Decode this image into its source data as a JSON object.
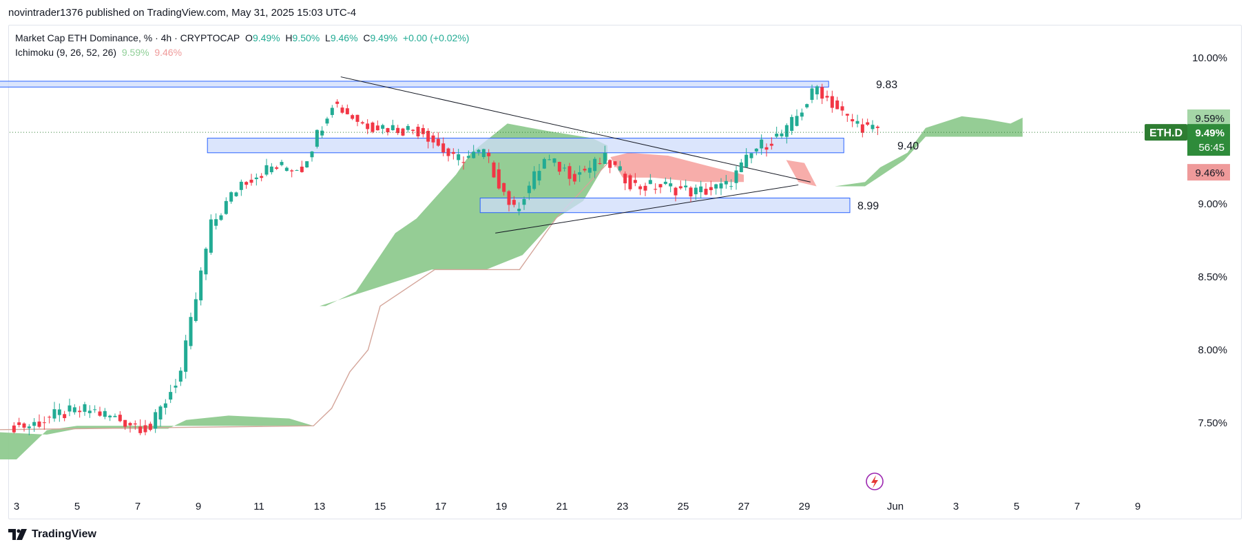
{
  "header": {
    "publisher_line": "novintrader1376 published on TradingView.com, May 31, 2025 15:03 UTC-4"
  },
  "legend": {
    "symbol_title": "Market Cap ETH Dominance, % · 4h · CRYPTOCAP",
    "open_label": "O",
    "open_value": "9.49%",
    "high_label": "H",
    "high_value": "9.50%",
    "low_label": "L",
    "low_value": "9.46%",
    "close_label": "C",
    "close_value": "9.49%",
    "change": "+0.00 (+0.02%)",
    "indicator_name": "Ichimoku (9, 26, 52, 26)",
    "indicator_value_1": "9.59%",
    "indicator_value_2": "9.46%"
  },
  "footer": {
    "brand": "TradingView"
  },
  "colors": {
    "up": "#22ab94",
    "down": "#f23645",
    "cloud_bull": "#8fca8f",
    "cloud_bear": "#f7a9a5",
    "zone_fill": "#cfdcfb",
    "zone_stroke": "#2962ff",
    "ticker_bg": "#2e7d32",
    "price_badge_green": "#2e8b3a",
    "span_a_badge": "#a5d6a7",
    "span_b_badge": "#ef9a9a"
  },
  "chart_data": {
    "type": "candlestick",
    "symbol": "ETH.D",
    "timeframe": "4h",
    "y_axis": {
      "ticks": [
        "10.00%",
        "9.50%",
        "9.00%",
        "8.50%",
        "8.00%",
        "7.50%"
      ],
      "ylim": [
        7.2,
        10.15
      ]
    },
    "x_axis": {
      "ticks": [
        "3",
        "5",
        "7",
        "9",
        "11",
        "13",
        "15",
        "17",
        "19",
        "21",
        "23",
        "25",
        "27",
        "29",
        "Jun",
        "3",
        "5",
        "7",
        "9"
      ]
    },
    "price_markers": {
      "ticker_label": "ETH.D",
      "current_price": "9.49%",
      "countdown": "56:45",
      "span_a": "9.59%",
      "span_b": "9.46%"
    },
    "horizontal_zones": [
      {
        "label": "9.83",
        "low": 9.8,
        "high": 9.84
      },
      {
        "label": "9.40",
        "low": 9.35,
        "high": 9.45
      },
      {
        "label": "8.99",
        "low": 8.94,
        "high": 9.04
      }
    ],
    "daily_closes": [
      {
        "day": "May 3",
        "close": 7.48
      },
      {
        "day": "May 4",
        "close": 7.56
      },
      {
        "day": "May 5",
        "close": 7.59
      },
      {
        "day": "May 6",
        "close": 7.52
      },
      {
        "day": "May 7",
        "close": 7.46
      },
      {
        "day": "May 8",
        "close": 7.85
      },
      {
        "day": "May 9",
        "close": 8.85
      },
      {
        "day": "May 10",
        "close": 9.15
      },
      {
        "day": "May 11",
        "close": 9.25
      },
      {
        "day": "May 12",
        "close": 9.25
      },
      {
        "day": "May 13",
        "close": 9.7
      },
      {
        "day": "May 14",
        "close": 9.55
      },
      {
        "day": "May 15",
        "close": 9.52
      },
      {
        "day": "May 16",
        "close": 9.5
      },
      {
        "day": "May 17",
        "close": 9.3
      },
      {
        "day": "May 18",
        "close": 9.35
      },
      {
        "day": "May 19",
        "close": 8.95
      },
      {
        "day": "May 20",
        "close": 9.3
      },
      {
        "day": "May 21",
        "close": 9.2
      },
      {
        "day": "May 22",
        "close": 9.3
      },
      {
        "day": "May 23",
        "close": 9.12
      },
      {
        "day": "May 24",
        "close": 9.12
      },
      {
        "day": "May 25",
        "close": 9.08
      },
      {
        "day": "May 26",
        "close": 9.12
      },
      {
        "day": "May 27",
        "close": 9.38
      },
      {
        "day": "May 28",
        "close": 9.5
      },
      {
        "day": "May 29",
        "close": 9.8
      },
      {
        "day": "May 30",
        "close": 9.58
      },
      {
        "day": "May 31",
        "close": 9.49
      }
    ]
  }
}
